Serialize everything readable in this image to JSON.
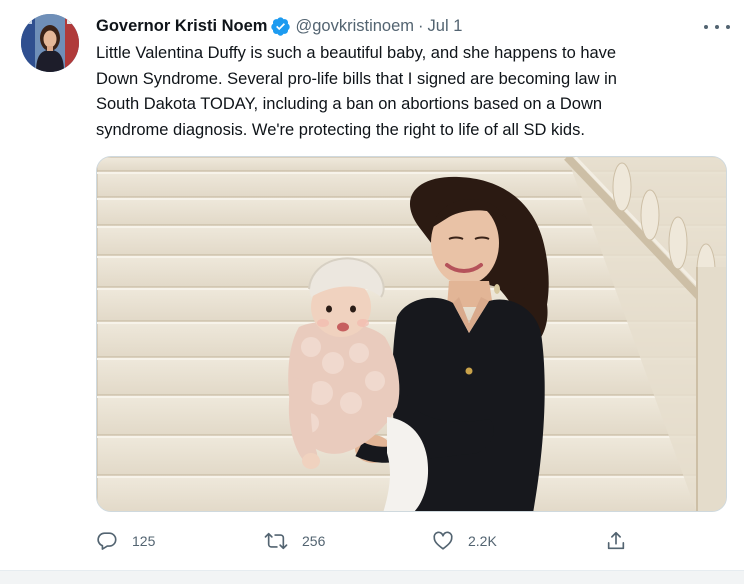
{
  "tweet": {
    "author": {
      "name": "Governor Kristi Noem",
      "handle": "@govkristinoem",
      "verified": true
    },
    "separator": "·",
    "timestamp": "Jul 1",
    "text_lines": [
      "Little Valentina Duffy is such a beautiful baby, and she happens to have",
      "Down Syndrome. Several pro-life bills that I signed are becoming law in",
      "South Dakota TODAY, including a ban on abortions based on a Down",
      "syndrome diagnosis. We're protecting the right to life of all SD kids."
    ],
    "actions": {
      "reply": {
        "icon": "reply-icon",
        "count": "125"
      },
      "retweet": {
        "icon": "retweet-icon",
        "count": "256"
      },
      "like": {
        "icon": "heart-icon",
        "count": "2.2K"
      },
      "share": {
        "icon": "share-icon"
      }
    }
  },
  "colors": {
    "text_primary": "#0f1419",
    "text_secondary": "#536471",
    "verified_blue": "#1d9bf0",
    "border": "#cfd9de"
  }
}
